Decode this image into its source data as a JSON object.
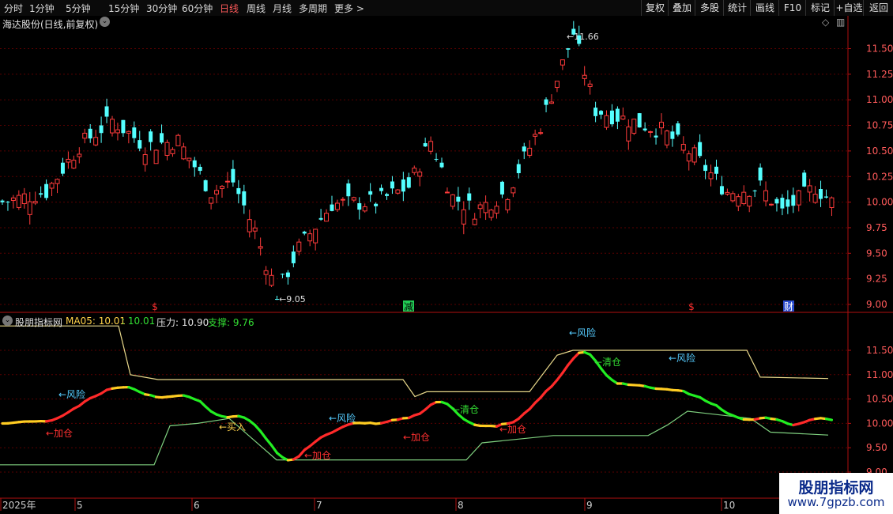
{
  "toolbar": {
    "periods": [
      "分时",
      "1分钟",
      "5分钟",
      "15分钟",
      "30分钟",
      "60分钟",
      "日线",
      "周线",
      "月线",
      "多周期",
      "更多 >"
    ],
    "active_period": "日线",
    "buttons": [
      "复权",
      "叠加",
      "多股",
      "统计",
      "画线",
      "F10",
      "标记",
      "+自选",
      "返回"
    ]
  },
  "main_header": {
    "title": "海达股份(日线,前复权)",
    "axis_ticks": [
      "11.50",
      "11.25",
      "11.00",
      "10.75",
      "10.50",
      "10.25",
      "10.00",
      "9.75",
      "9.50",
      "9.25",
      "9.00"
    ],
    "high_label": "11.66",
    "low_label": "9.05",
    "markers": [
      {
        "text": "$",
        "color": "#ff3030"
      },
      {
        "text": "减",
        "color": "#000000",
        "bg": "#22cc55"
      },
      {
        "text": "$",
        "color": "#ff3030"
      },
      {
        "text": "财",
        "color": "#ffffff",
        "bg": "#2a4ccf"
      }
    ]
  },
  "indicator": {
    "name": "股朋指标网",
    "ma_label": "MA05: 10.01",
    "ma_value2": ": 10.01",
    "pressure_label": "压力: 10.90",
    "support_label": "支撑: 9.76",
    "axis_ticks": [
      "11.50",
      "11.00",
      "10.50",
      "10.00",
      "9.50",
      "9.00"
    ],
    "annotations": [
      {
        "text": "←风险",
        "color": "#55ccff"
      },
      {
        "text": "←加仓",
        "color": "#ff3030"
      },
      {
        "text": "←买入",
        "color": "#ffd24a"
      },
      {
        "text": "←加仓",
        "color": "#ff3030"
      },
      {
        "text": "←风险",
        "color": "#55ccff"
      },
      {
        "text": "←加仓",
        "color": "#ff3030"
      },
      {
        "text": "←清仓",
        "color": "#33dd33"
      },
      {
        "text": "←加仓",
        "color": "#ff3030"
      },
      {
        "text": "←风险",
        "color": "#55ccff"
      },
      {
        "text": "←清仓",
        "color": "#33dd33"
      },
      {
        "text": "←风险",
        "color": "#55ccff"
      }
    ]
  },
  "time_axis": [
    "2025年",
    "5",
    "6",
    "7",
    "8",
    "9",
    "10"
  ],
  "watermark": {
    "line1": "股朋指标网",
    "line2": "www.7gpzb.com"
  },
  "colors": {
    "up": "#ff3b3b",
    "down": "#54ffff",
    "grid": "#5a0000",
    "axis": "#b01010",
    "pressure": "#e8d88a",
    "support": "#7fd07f"
  }
}
